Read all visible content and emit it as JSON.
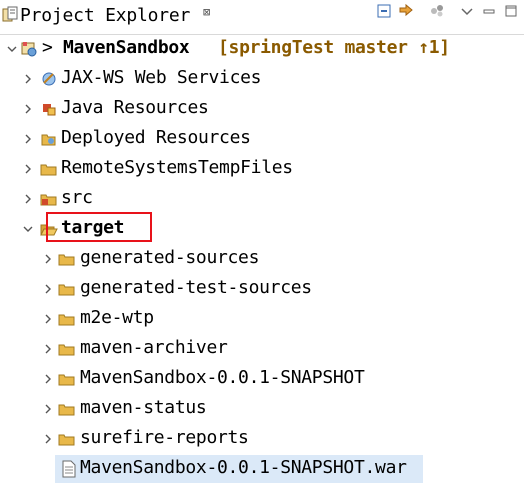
{
  "view": {
    "title": "Project Explorer",
    "close_glyph": "⊠"
  },
  "toolbar": {
    "collapse_icon": "collapse-all-icon",
    "link_icon": "link-with-editor-icon",
    "focus_icon": "focus-icon",
    "menu_icon": "view-menu-chevron-icon",
    "minimize_icon": "minimize-icon",
    "maximize_icon": "maximize-icon"
  },
  "tree": {
    "project": {
      "prefix": ">",
      "name": "MavenSandbox",
      "decoration": "[springTest master ↑1]"
    },
    "items": [
      {
        "label": "JAX-WS Web Services",
        "icon": "web-services-icon"
      },
      {
        "label": "Java Resources",
        "icon": "java-resources-icon"
      },
      {
        "label": "Deployed Resources",
        "icon": "deployed-resources-icon"
      },
      {
        "label": "RemoteSystemsTempFiles",
        "icon": "folder-icon"
      },
      {
        "label": "src",
        "icon": "source-folder-icon"
      },
      {
        "label": "target",
        "icon": "folder-open-icon"
      }
    ],
    "target_children": [
      {
        "label": "generated-sources"
      },
      {
        "label": "generated-test-sources"
      },
      {
        "label": "m2e-wtp"
      },
      {
        "label": "maven-archiver"
      },
      {
        "label": "MavenSandbox-0.0.1-SNAPSHOT"
      },
      {
        "label": "maven-status"
      },
      {
        "label": "surefire-reports"
      }
    ],
    "file": {
      "label": "MavenSandbox-0.0.1-SNAPSHOT.war"
    }
  },
  "colors": {
    "folder": "#e8b84a",
    "selection": "#dbe9f8",
    "highlight_box": "#e8121a"
  }
}
